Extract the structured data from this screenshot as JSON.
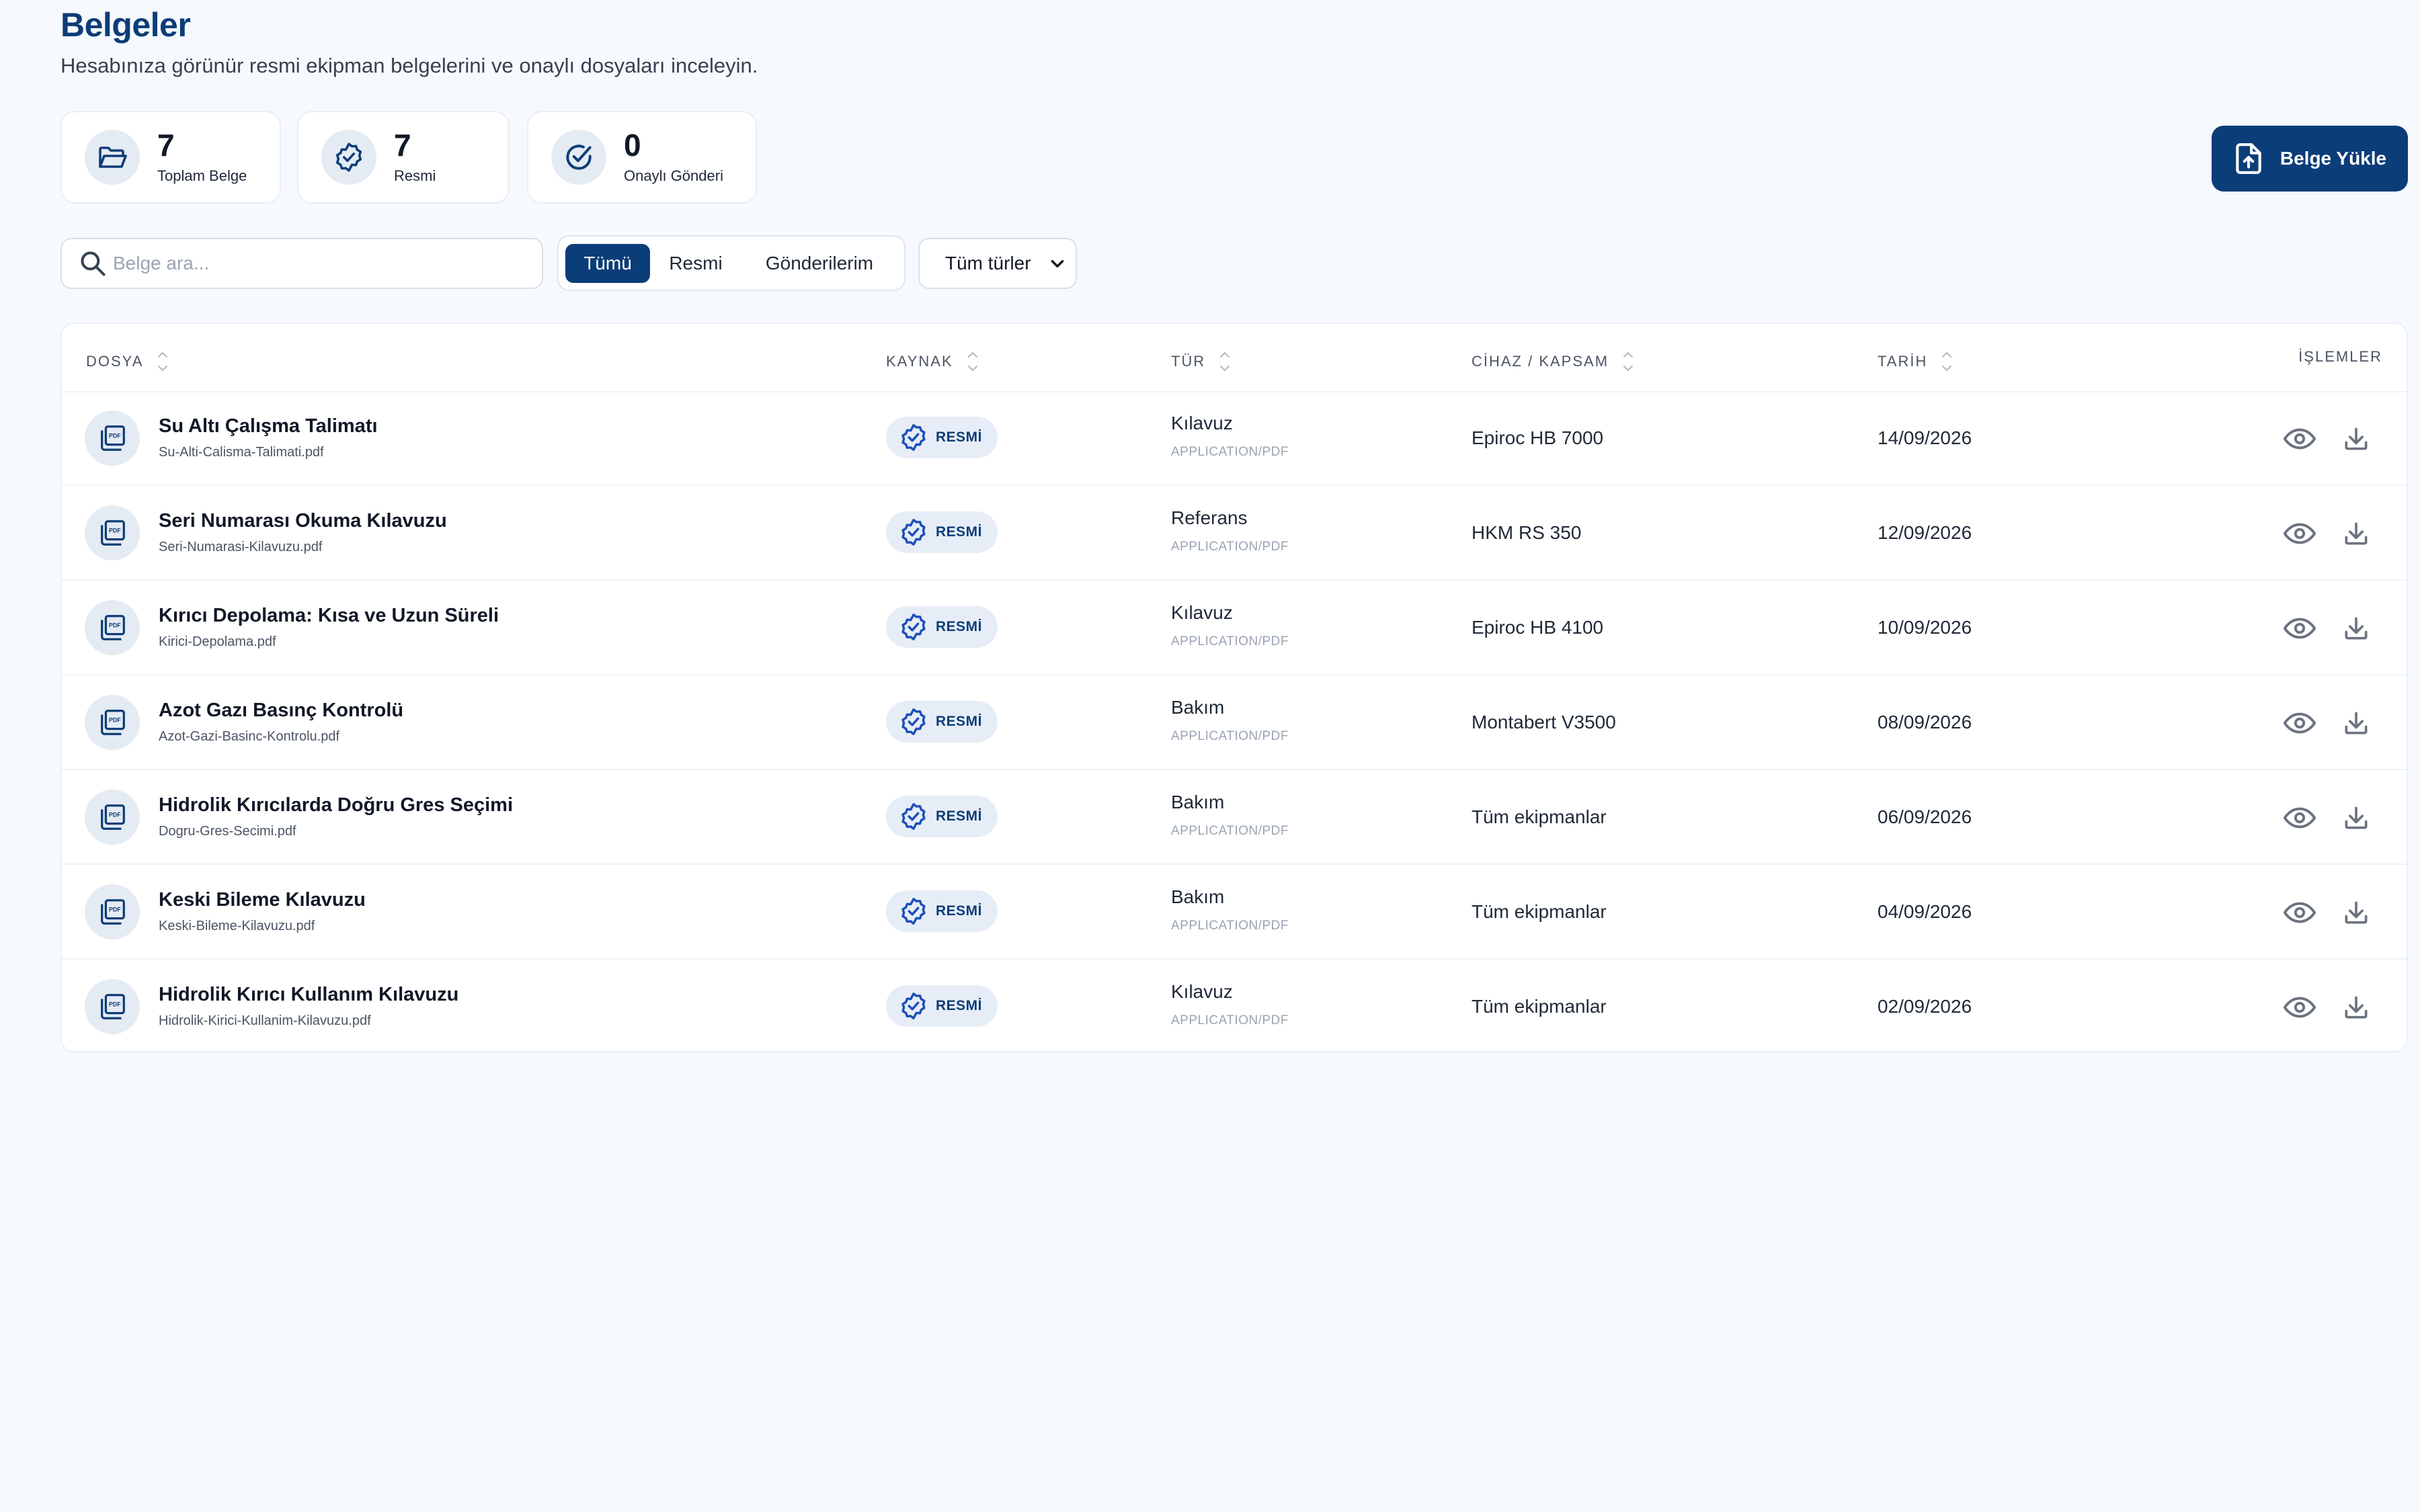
{
  "header": {
    "title": "Belgeler",
    "subtitle": "Hesabınıza görünür resmi ekipman belgelerini ve onaylı dosyaları inceleyin."
  },
  "stats": [
    {
      "value": "7",
      "label": "Toplam Belge",
      "icon": "folder-open-icon"
    },
    {
      "value": "7",
      "label": "Resmi",
      "icon": "verified-badge-icon"
    },
    {
      "value": "0",
      "label": "Onaylı Gönderi",
      "icon": "check-circle-icon"
    }
  ],
  "upload_button": {
    "label": "Belge Yükle",
    "icon": "file-upload-icon"
  },
  "search": {
    "placeholder": "Belge ara...",
    "value": ""
  },
  "filter_tabs": [
    {
      "label": "Tümü",
      "active": true
    },
    {
      "label": "Resmi",
      "active": false
    },
    {
      "label": "Gönderilerim",
      "active": false
    }
  ],
  "type_filter": {
    "selected": "Tüm türler"
  },
  "table": {
    "columns": [
      "DOSYA",
      "KAYNAK",
      "TÜR",
      "CİHAZ / KAPSAM",
      "TARİH",
      "İŞLEMLER"
    ],
    "rows": [
      {
        "name": "Su Altı Çalışma Talimatı",
        "file": "Su-Alti-Calisma-Talimati.pdf",
        "source": "RESMİ",
        "type": "Kılavuz",
        "mime": "APPLICATION/PDF",
        "scope": "Epiroc HB 7000",
        "date": "14/09/2026"
      },
      {
        "name": "Seri Numarası Okuma Kılavuzu",
        "file": "Seri-Numarasi-Kilavuzu.pdf",
        "source": "RESMİ",
        "type": "Referans",
        "mime": "APPLICATION/PDF",
        "scope": "HKM RS 350",
        "date": "12/09/2026"
      },
      {
        "name": "Kırıcı Depolama: Kısa ve Uzun Süreli",
        "file": "Kirici-Depolama.pdf",
        "source": "RESMİ",
        "type": "Kılavuz",
        "mime": "APPLICATION/PDF",
        "scope": "Epiroc HB 4100",
        "date": "10/09/2026"
      },
      {
        "name": "Azot Gazı Basınç Kontrolü",
        "file": "Azot-Gazi-Basinc-Kontrolu.pdf",
        "source": "RESMİ",
        "type": "Bakım",
        "mime": "APPLICATION/PDF",
        "scope": "Montabert V3500",
        "date": "08/09/2026"
      },
      {
        "name": "Hidrolik Kırıcılarda Doğru Gres Seçimi",
        "file": "Dogru-Gres-Secimi.pdf",
        "source": "RESMİ",
        "type": "Bakım",
        "mime": "APPLICATION/PDF",
        "scope": "Tüm ekipmanlar",
        "date": "06/09/2026"
      },
      {
        "name": "Keski Bileme Kılavuzu",
        "file": "Keski-Bileme-Kilavuzu.pdf",
        "source": "RESMİ",
        "type": "Bakım",
        "mime": "APPLICATION/PDF",
        "scope": "Tüm ekipmanlar",
        "date": "04/09/2026"
      },
      {
        "name": "Hidrolik Kırıcı Kullanım Kılavuzu",
        "file": "Hidrolik-Kirici-Kullanim-Kilavuzu.pdf",
        "source": "RESMİ",
        "type": "Kılavuz",
        "mime": "APPLICATION/PDF",
        "scope": "Tüm ekipmanlar",
        "date": "02/09/2026"
      }
    ]
  },
  "colors": {
    "primary": "#0b3d78",
    "background": "#f6f9fd",
    "icon_bg": "#e5ebf3",
    "badge_bg": "#e7edf6"
  }
}
